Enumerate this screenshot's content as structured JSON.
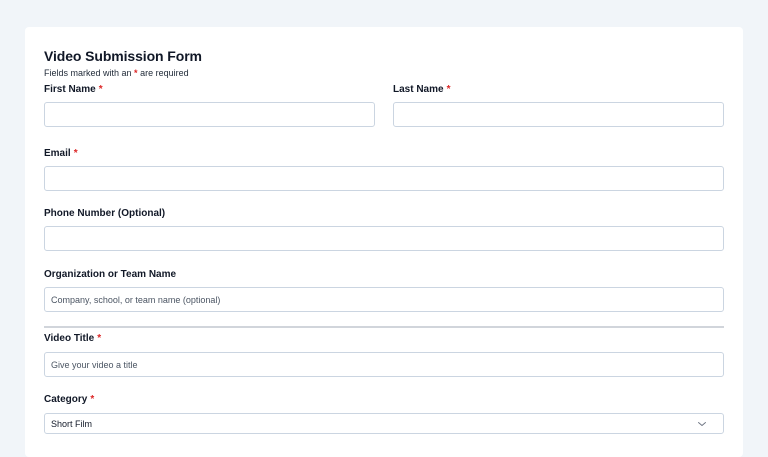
{
  "form": {
    "title": "Video Submission Form",
    "note_prefix": "Fields marked with an ",
    "note_star": "*",
    "note_suffix": " are required",
    "required_marker": "*"
  },
  "fields": {
    "first_name": {
      "label": "First Name",
      "value": "",
      "placeholder": ""
    },
    "last_name": {
      "label": "Last Name",
      "value": "",
      "placeholder": ""
    },
    "email": {
      "label": "Email",
      "value": "",
      "placeholder": ""
    },
    "phone": {
      "label": "Phone Number (Optional)",
      "value": "",
      "placeholder": ""
    },
    "organization": {
      "label": "Organization or Team Name",
      "value": "",
      "placeholder": "Company, school, or team name (optional)"
    },
    "video_title": {
      "label": "Video Title",
      "value": "",
      "placeholder": "Give your video a title"
    },
    "category": {
      "label": "Category",
      "selected": "Short Film"
    }
  },
  "icons": {
    "category_dropdown": "chevron-down-icon"
  },
  "colors": {
    "page_background": "#f1f5f9",
    "card_background": "#ffffff",
    "required_star": "#dc2626",
    "input_border": "#cbd5e1"
  }
}
